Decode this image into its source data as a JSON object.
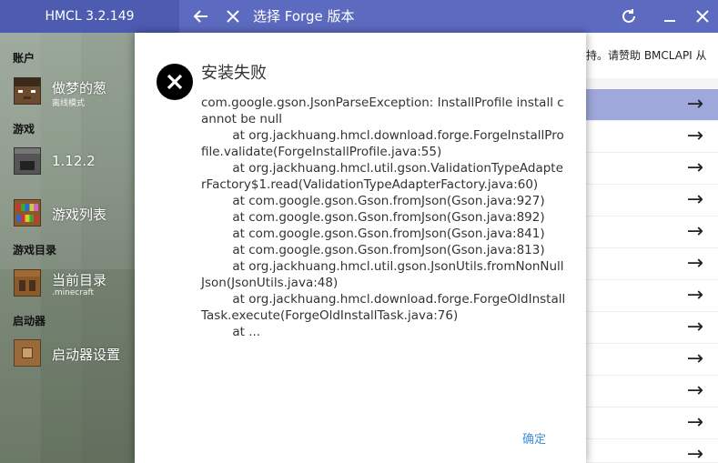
{
  "titlebar": {
    "app_title": "HMCL 3.2.149",
    "window_title": "选择 Forge 版本",
    "back_icon": "arrow-left-icon",
    "close_icon": "close-icon",
    "refresh_icon": "refresh-icon",
    "minimize_icon": "minimize-icon",
    "window_close_icon": "window-close-icon"
  },
  "sidebar": {
    "sections": {
      "account": "账户",
      "game": "游戏",
      "game_dir": "游戏目录",
      "launcher": "启动器"
    },
    "account": {
      "name": "做梦的葱",
      "mode": "离线模式"
    },
    "game_items": [
      {
        "label": "1.12.2"
      },
      {
        "label": "游戏列表"
      }
    ],
    "dir_item": {
      "label": "当前目录",
      "sublabel": ".minecraft"
    },
    "launcher_item": {
      "label": "启动器设置"
    }
  },
  "right_panel": {
    "banner_text": "持。请赞助 BMCLAPI 从",
    "row_count_note": "",
    "arrow_icon": "arrow-right-icon"
  },
  "dialog": {
    "title": "安装失败",
    "icon": "error-x-icon",
    "message": "com.google.gson.JsonParseException: InstallProfile install cannot be null\n        at org.jackhuang.hmcl.download.forge.ForgeInstallProfile.validate(ForgeInstallProfile.java:55)\n        at org.jackhuang.hmcl.util.gson.ValidationTypeAdapterFactory$1.read(ValidationTypeAdapterFactory.java:60)\n        at com.google.gson.Gson.fromJson(Gson.java:927)\n        at com.google.gson.Gson.fromJson(Gson.java:892)\n        at com.google.gson.Gson.fromJson(Gson.java:841)\n        at com.google.gson.Gson.fromJson(Gson.java:813)\n        at org.jackhuang.hmcl.util.gson.JsonUtils.fromNonNullJson(JsonUtils.java:48)\n        at org.jackhuang.hmcl.download.forge.ForgeOldInstallTask.execute(ForgeOldInstallTask.java:76)\n        at ...",
    "ok_label": "确定"
  },
  "colors": {
    "accent": "#5c6bc0",
    "selected_row": "#9fa8da",
    "link": "#3f8fd8"
  }
}
